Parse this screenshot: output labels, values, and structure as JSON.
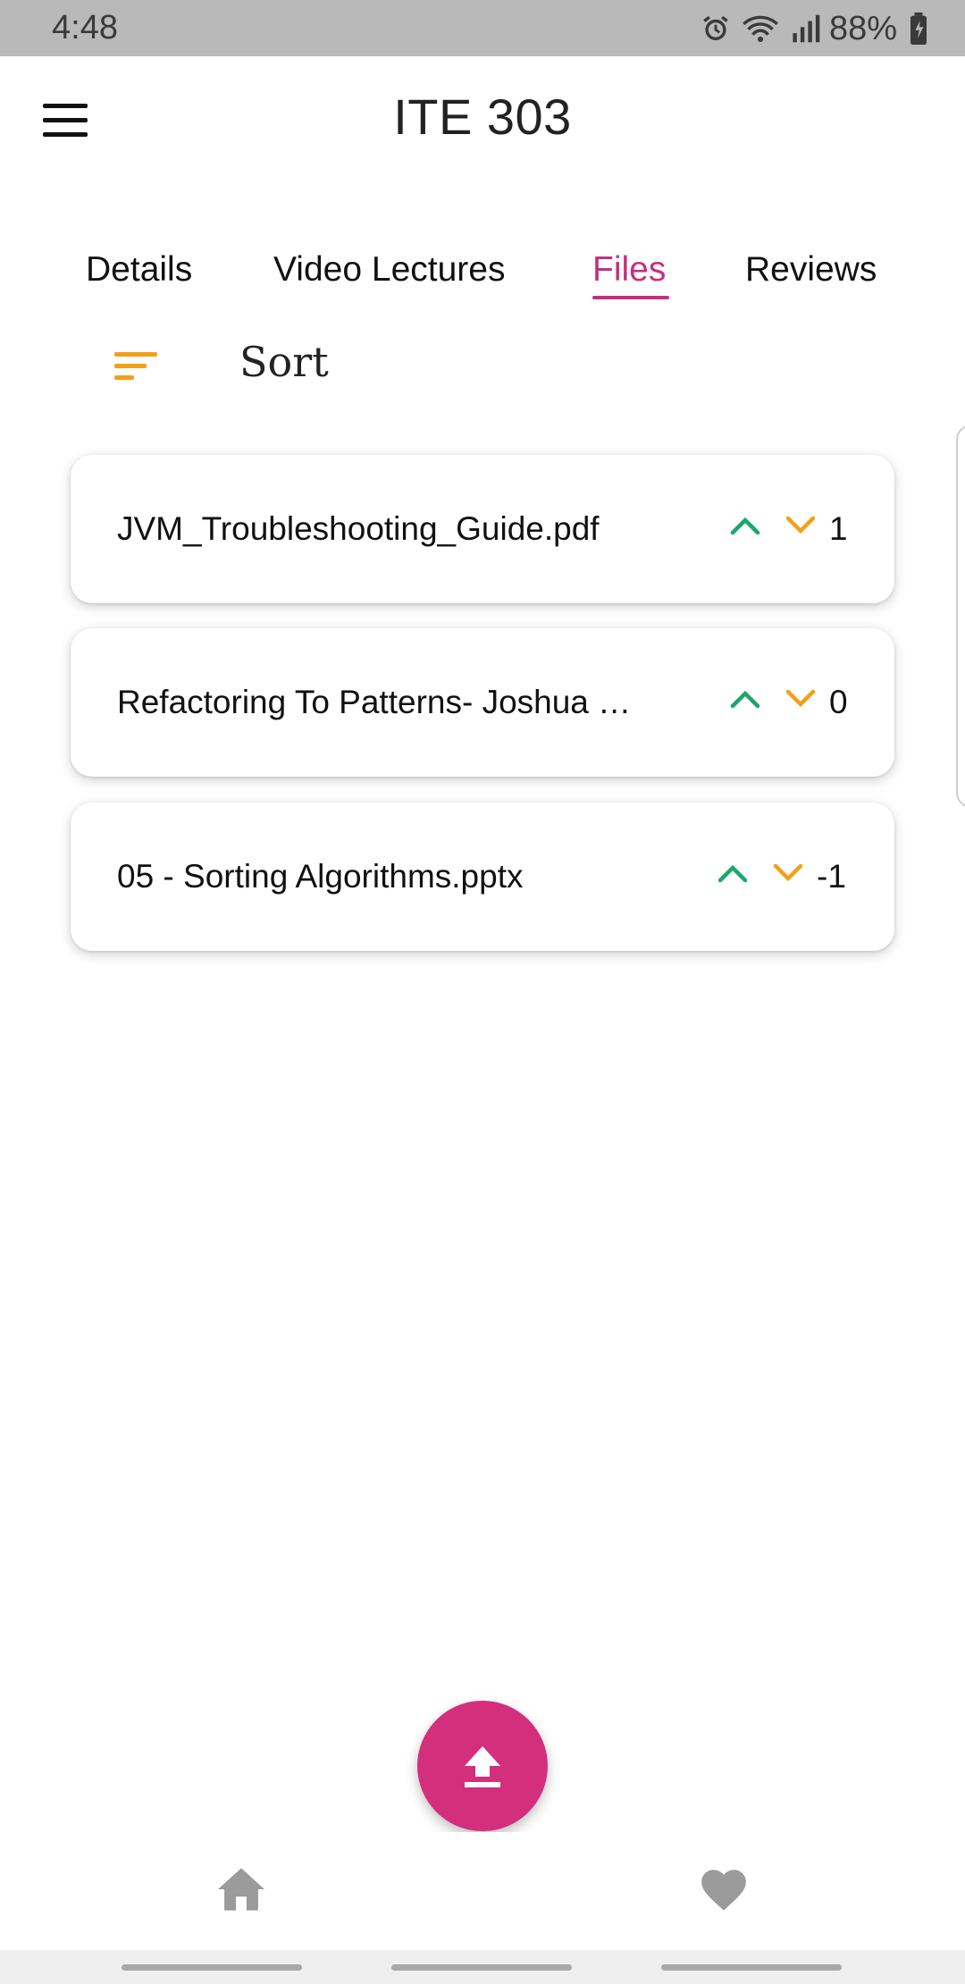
{
  "status_bar": {
    "time": "4:48",
    "battery": "88%",
    "icons": [
      "alarm-icon",
      "wifi-icon",
      "signal-icon",
      "battery-charging-icon"
    ]
  },
  "app_bar": {
    "title": "ITE 303",
    "menu_icon": "menu-icon"
  },
  "tabs": [
    {
      "label": "Details",
      "active": false
    },
    {
      "label": "Video Lectures",
      "active": false
    },
    {
      "label": "Files",
      "active": true
    },
    {
      "label": "Reviews",
      "active": false
    }
  ],
  "sort": {
    "label": "Sort",
    "icon": "sort-icon"
  },
  "files": [
    {
      "name": "JVM_Troubleshooting_Guide.pdf",
      "votes": "1"
    },
    {
      "name": "Refactoring To Patterns- Joshua …",
      "votes": "0"
    },
    {
      "name": "05 - Sorting Algorithms.pptx",
      "votes": "-1"
    }
  ],
  "fab": {
    "icon": "upload-icon"
  },
  "bottom_nav": [
    {
      "icon": "home-icon"
    },
    {
      "icon": "heart-icon"
    }
  ],
  "colors": {
    "accent": "#c4307f",
    "fab": "#d42f7d",
    "upvote": "#1aa86a",
    "downvote": "#f2a01c",
    "sort": "#f2a01c"
  }
}
